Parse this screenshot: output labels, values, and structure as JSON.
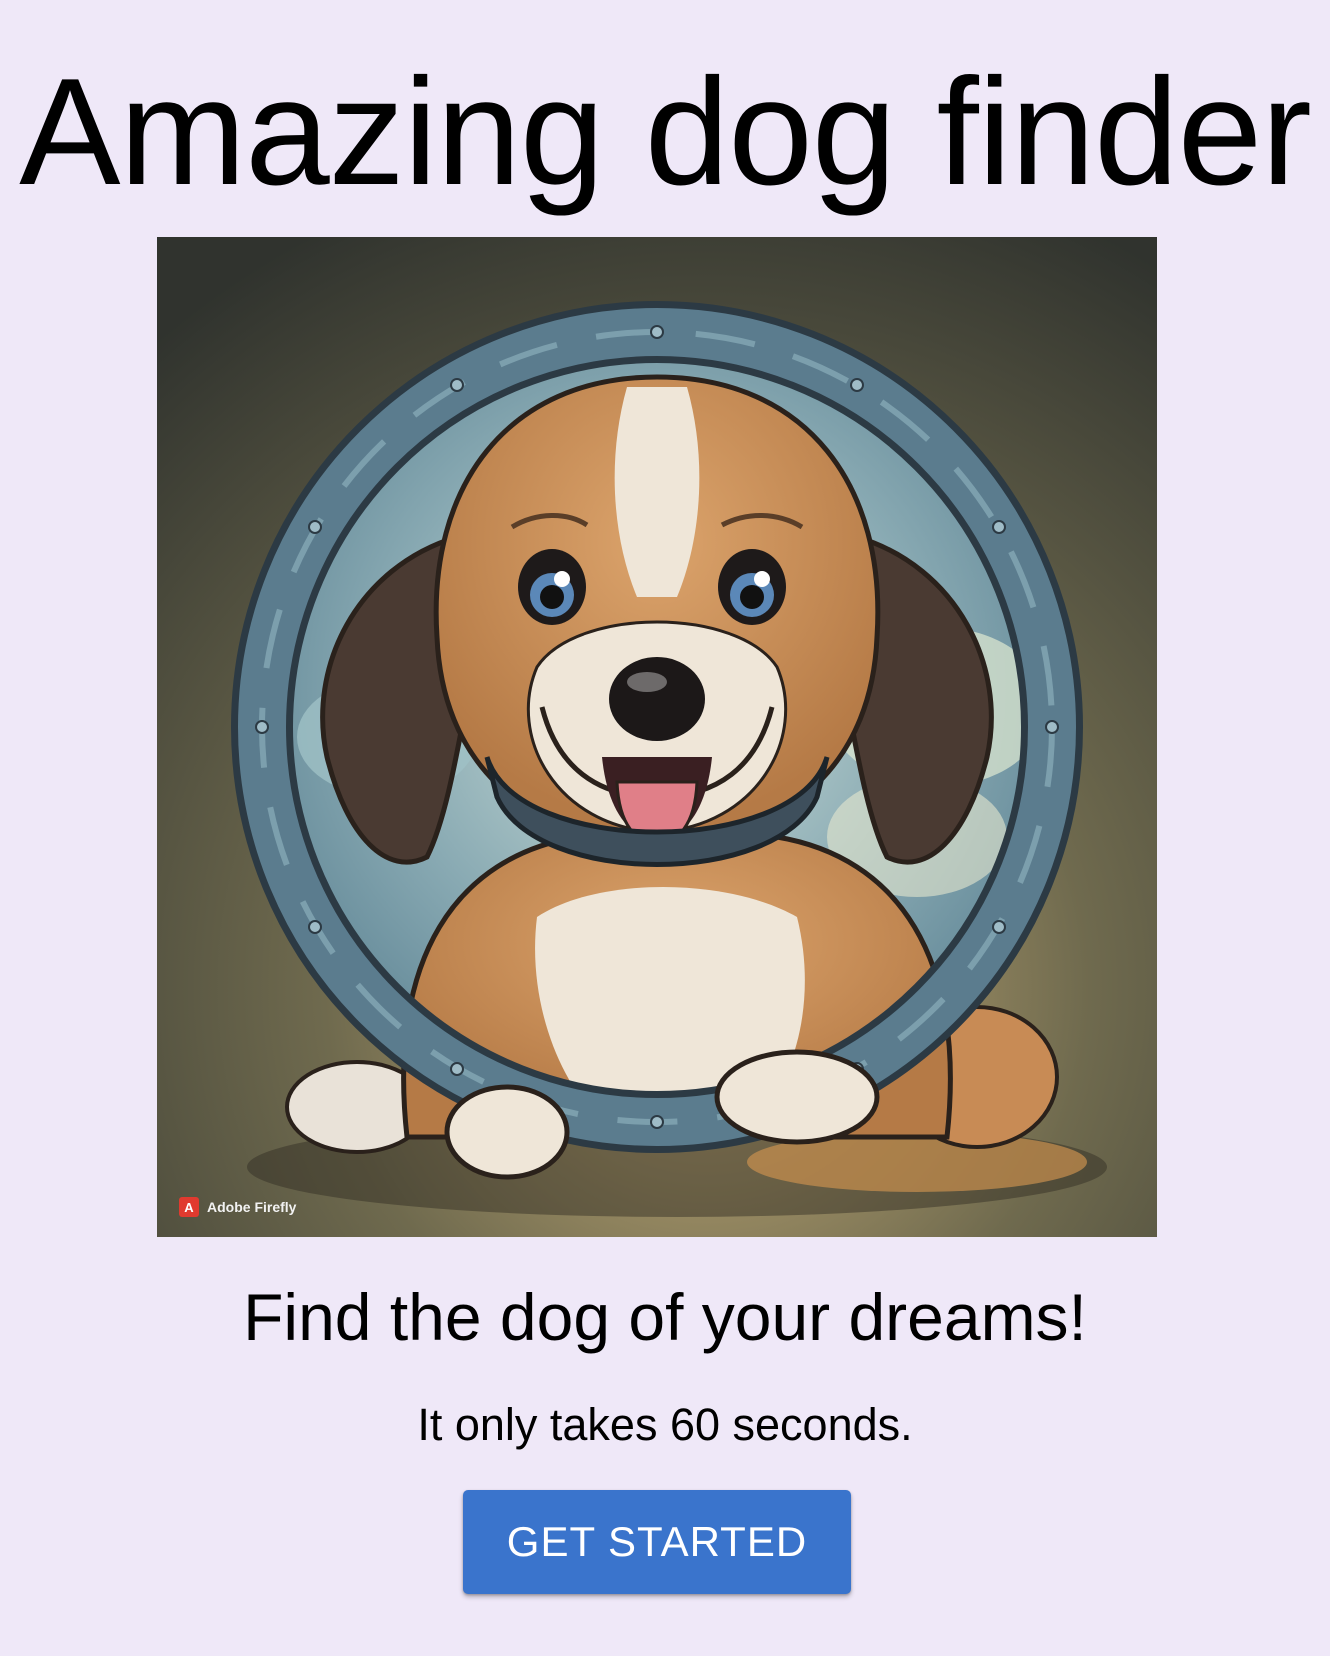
{
  "header": {
    "title": "Amazing dog finder"
  },
  "hero": {
    "image_subject": "cartoon-puppy-in-porthole",
    "watermark_text": "Adobe Firefly",
    "watermark_logo_glyph": "A",
    "colors": {
      "background_dark": "#3a3d36",
      "ring": "#4f6f82",
      "fur": "#c98e58",
      "fur_light": "#efe6d8",
      "ear": "#4a3a32",
      "eye": "#5b88b8",
      "tongue": "#e07f88",
      "collar": "#3e4f5c"
    }
  },
  "main": {
    "subtitle": "Find the dog of your dreams!",
    "tagline": "It only takes 60 seconds.",
    "cta_label": "GET STARTED"
  },
  "theme": {
    "page_background": "#efe8f8",
    "button_color": "#3a74cc",
    "button_text_color": "#ffffff"
  }
}
